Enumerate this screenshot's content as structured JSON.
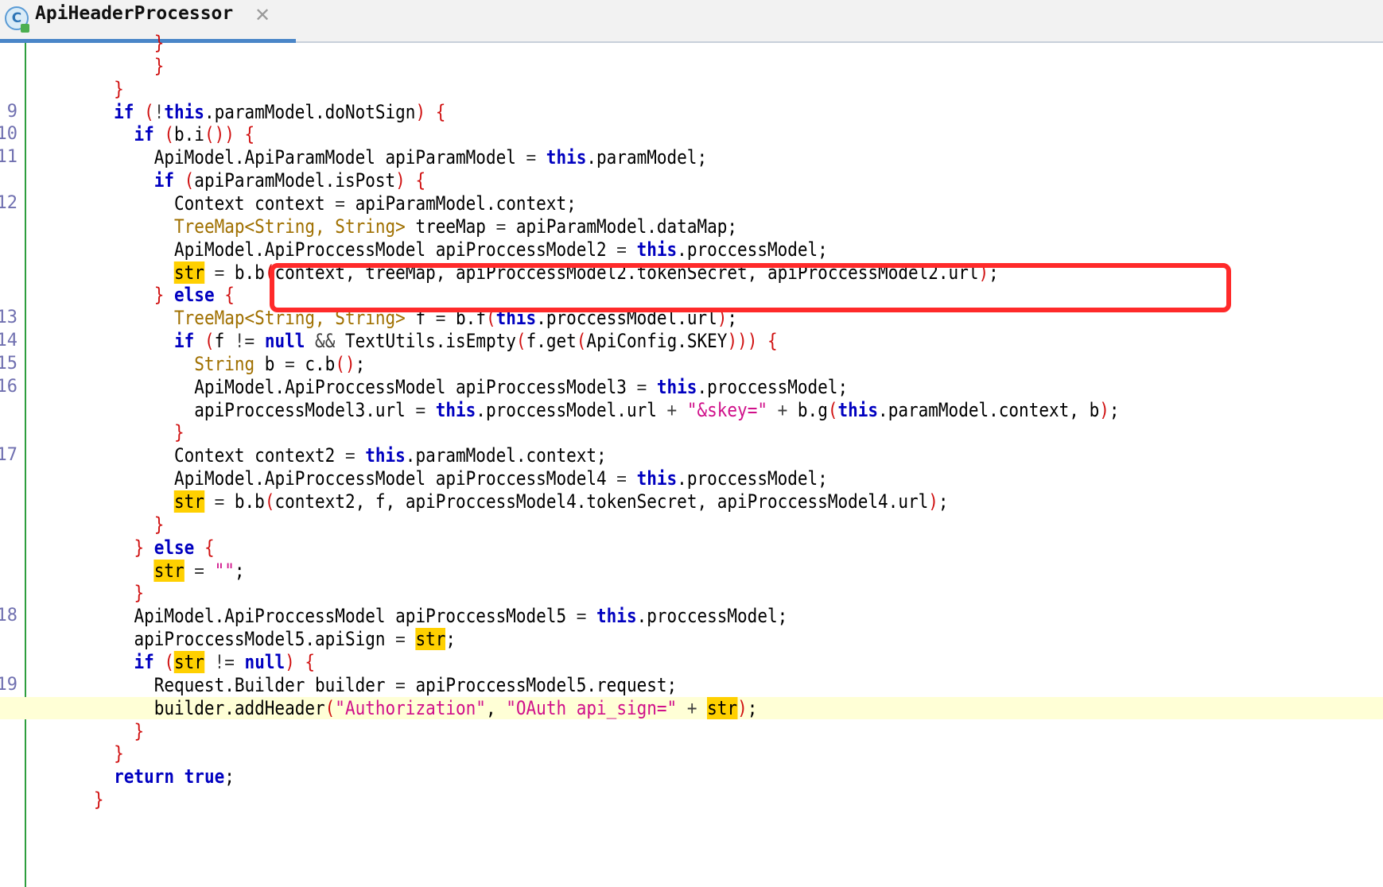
{
  "tab": {
    "title": "ApiHeaderProcessor",
    "icon_letter": "C",
    "icon": "java-class-icon",
    "close_icon": "close-icon"
  },
  "colors": {
    "keyword": "#0000c0",
    "bracket": "#d01010",
    "type": "#a07000",
    "string": "#d0108a",
    "highlight": "#ffd000",
    "current_line": "#ffffd6",
    "callout": "#ff2a2a",
    "gutter_border": "#2e9e3e"
  },
  "code_lines": [
    {
      "ln": "",
      "indent": 12,
      "cut_top": true,
      "tokens": [
        {
          "t": "}",
          "k": "br"
        }
      ]
    },
    {
      "ln": "",
      "indent": 12,
      "tokens": [
        {
          "t": "}",
          "k": "br"
        }
      ]
    },
    {
      "ln": "",
      "indent": 8,
      "tokens": [
        {
          "t": "}",
          "k": "br"
        }
      ]
    },
    {
      "ln": "9",
      "indent": 8,
      "tokens": [
        {
          "t": "if",
          "k": "kw"
        },
        {
          "t": " ",
          "k": "pl"
        },
        {
          "t": "(",
          "k": "br"
        },
        {
          "t": "!",
          "k": "op"
        },
        {
          "t": "this",
          "k": "kw"
        },
        {
          "t": ".paramModel.doNotSign",
          "k": "pl"
        },
        {
          "t": ")",
          "k": "br"
        },
        {
          "t": " ",
          "k": "pl"
        },
        {
          "t": "{",
          "k": "br"
        }
      ]
    },
    {
      "ln": "10",
      "indent": 10,
      "tokens": [
        {
          "t": "if",
          "k": "kw"
        },
        {
          "t": " ",
          "k": "pl"
        },
        {
          "t": "(",
          "k": "br"
        },
        {
          "t": "b.i",
          "k": "pl"
        },
        {
          "t": "())",
          "k": "br"
        },
        {
          "t": " ",
          "k": "pl"
        },
        {
          "t": "{",
          "k": "br"
        }
      ]
    },
    {
      "ln": "11",
      "indent": 12,
      "tokens": [
        {
          "t": "ApiModel.ApiParamModel apiParamModel ",
          "k": "pl"
        },
        {
          "t": "=",
          "k": "op"
        },
        {
          "t": " ",
          "k": "pl"
        },
        {
          "t": "this",
          "k": "kw"
        },
        {
          "t": ".paramModel;",
          "k": "pl"
        }
      ]
    },
    {
      "ln": "",
      "indent": 12,
      "tokens": [
        {
          "t": "if",
          "k": "kw"
        },
        {
          "t": " ",
          "k": "pl"
        },
        {
          "t": "(",
          "k": "br"
        },
        {
          "t": "apiParamModel.isPost",
          "k": "pl"
        },
        {
          "t": ")",
          "k": "br"
        },
        {
          "t": " ",
          "k": "pl"
        },
        {
          "t": "{",
          "k": "br"
        }
      ]
    },
    {
      "ln": "12",
      "indent": 14,
      "tokens": [
        {
          "t": "Context context ",
          "k": "pl"
        },
        {
          "t": "=",
          "k": "op"
        },
        {
          "t": " apiParamModel.context;",
          "k": "pl"
        }
      ]
    },
    {
      "ln": "",
      "indent": 14,
      "tokens": [
        {
          "t": "TreeMap<String, String>",
          "k": "ty"
        },
        {
          "t": " treeMap ",
          "k": "pl"
        },
        {
          "t": "=",
          "k": "op"
        },
        {
          "t": " apiParamModel.dataMap;",
          "k": "pl"
        }
      ]
    },
    {
      "ln": "",
      "indent": 14,
      "obscured": true,
      "tokens": [
        {
          "t": "ApiModel.ApiProccessModel apiProccessModel2 ",
          "k": "pl"
        },
        {
          "t": "=",
          "k": "op"
        },
        {
          "t": " ",
          "k": "pl"
        },
        {
          "t": "this",
          "k": "kw"
        },
        {
          "t": ".proccessModel;",
          "k": "pl"
        }
      ]
    },
    {
      "ln": "",
      "indent": 14,
      "tokens": [
        {
          "t": "str",
          "k": "hl"
        },
        {
          "t": " ",
          "k": "pl"
        },
        {
          "t": "=",
          "k": "op"
        },
        {
          "t": " b.b",
          "k": "pl"
        },
        {
          "t": "(",
          "k": "br"
        },
        {
          "t": "context, treeMap, apiProccessModel2.tokenSecret, apiProccessModel2.url",
          "k": "pl"
        },
        {
          "t": ")",
          "k": "br"
        },
        {
          "t": ";",
          "k": "pl"
        }
      ]
    },
    {
      "ln": "",
      "indent": 12,
      "obscured": true,
      "tokens": [
        {
          "t": "}",
          "k": "br"
        },
        {
          "t": " ",
          "k": "pl"
        },
        {
          "t": "else",
          "k": "kw"
        },
        {
          "t": " ",
          "k": "pl"
        },
        {
          "t": "{",
          "k": "br"
        }
      ]
    },
    {
      "ln": "13",
      "indent": 14,
      "tokens": [
        {
          "t": "TreeMap<String, String>",
          "k": "ty"
        },
        {
          "t": " f ",
          "k": "pl"
        },
        {
          "t": "=",
          "k": "op"
        },
        {
          "t": " b.f",
          "k": "pl"
        },
        {
          "t": "(",
          "k": "br"
        },
        {
          "t": "this",
          "k": "kw"
        },
        {
          "t": ".proccessModel.url",
          "k": "pl"
        },
        {
          "t": ")",
          "k": "br"
        },
        {
          "t": ";",
          "k": "pl"
        }
      ]
    },
    {
      "ln": "14",
      "indent": 14,
      "tokens": [
        {
          "t": "if",
          "k": "kw"
        },
        {
          "t": " ",
          "k": "pl"
        },
        {
          "t": "(",
          "k": "br"
        },
        {
          "t": "f ",
          "k": "pl"
        },
        {
          "t": "!=",
          "k": "op"
        },
        {
          "t": " ",
          "k": "pl"
        },
        {
          "t": "null",
          "k": "kw"
        },
        {
          "t": " ",
          "k": "pl"
        },
        {
          "t": "&&",
          "k": "op"
        },
        {
          "t": " TextUtils.isEmpty",
          "k": "pl"
        },
        {
          "t": "(",
          "k": "br"
        },
        {
          "t": "f.get",
          "k": "pl"
        },
        {
          "t": "(",
          "k": "br"
        },
        {
          "t": "ApiConfig.SKEY",
          "k": "pl"
        },
        {
          "t": ")))",
          "k": "br"
        },
        {
          "t": " ",
          "k": "pl"
        },
        {
          "t": "{",
          "k": "br"
        }
      ]
    },
    {
      "ln": "15",
      "indent": 16,
      "tokens": [
        {
          "t": "String",
          "k": "ty"
        },
        {
          "t": " b ",
          "k": "pl"
        },
        {
          "t": "=",
          "k": "op"
        },
        {
          "t": " c.b",
          "k": "pl"
        },
        {
          "t": "()",
          "k": "br"
        },
        {
          "t": ";",
          "k": "pl"
        }
      ]
    },
    {
      "ln": "16",
      "indent": 16,
      "tokens": [
        {
          "t": "ApiModel.ApiProccessModel apiProccessModel3 ",
          "k": "pl"
        },
        {
          "t": "=",
          "k": "op"
        },
        {
          "t": " ",
          "k": "pl"
        },
        {
          "t": "this",
          "k": "kw"
        },
        {
          "t": ".proccessModel;",
          "k": "pl"
        }
      ]
    },
    {
      "ln": "",
      "indent": 16,
      "tokens": [
        {
          "t": "apiProccessModel3.url ",
          "k": "pl"
        },
        {
          "t": "=",
          "k": "op"
        },
        {
          "t": " ",
          "k": "pl"
        },
        {
          "t": "this",
          "k": "kw"
        },
        {
          "t": ".proccessModel.url ",
          "k": "pl"
        },
        {
          "t": "+",
          "k": "op"
        },
        {
          "t": " ",
          "k": "pl"
        },
        {
          "t": "\"&skey=\"",
          "k": "st"
        },
        {
          "t": " ",
          "k": "pl"
        },
        {
          "t": "+",
          "k": "op"
        },
        {
          "t": " b.g",
          "k": "pl"
        },
        {
          "t": "(",
          "k": "br"
        },
        {
          "t": "this",
          "k": "kw"
        },
        {
          "t": ".paramModel.context, b",
          "k": "pl"
        },
        {
          "t": ")",
          "k": "br"
        },
        {
          "t": ";",
          "k": "pl"
        }
      ]
    },
    {
      "ln": "",
      "indent": 14,
      "tokens": [
        {
          "t": "}",
          "k": "br"
        }
      ]
    },
    {
      "ln": "17",
      "indent": 14,
      "tokens": [
        {
          "t": "Context context2 ",
          "k": "pl"
        },
        {
          "t": "=",
          "k": "op"
        },
        {
          "t": " ",
          "k": "pl"
        },
        {
          "t": "this",
          "k": "kw"
        },
        {
          "t": ".paramModel.context;",
          "k": "pl"
        }
      ]
    },
    {
      "ln": "",
      "indent": 14,
      "tokens": [
        {
          "t": "ApiModel.ApiProccessModel apiProccessModel4 ",
          "k": "pl"
        },
        {
          "t": "=",
          "k": "op"
        },
        {
          "t": " ",
          "k": "pl"
        },
        {
          "t": "this",
          "k": "kw"
        },
        {
          "t": ".proccessModel;",
          "k": "pl"
        }
      ]
    },
    {
      "ln": "",
      "indent": 14,
      "tokens": [
        {
          "t": "str",
          "k": "hl"
        },
        {
          "t": " ",
          "k": "pl"
        },
        {
          "t": "=",
          "k": "op"
        },
        {
          "t": " b.b",
          "k": "pl"
        },
        {
          "t": "(",
          "k": "br"
        },
        {
          "t": "context2, f, apiProccessModel4.tokenSecret, apiProccessModel4.url",
          "k": "pl"
        },
        {
          "t": ")",
          "k": "br"
        },
        {
          "t": ";",
          "k": "pl"
        }
      ]
    },
    {
      "ln": "",
      "indent": 12,
      "tokens": [
        {
          "t": "}",
          "k": "br"
        }
      ]
    },
    {
      "ln": "",
      "indent": 10,
      "tokens": [
        {
          "t": "}",
          "k": "br"
        },
        {
          "t": " ",
          "k": "pl"
        },
        {
          "t": "else",
          "k": "kw"
        },
        {
          "t": " ",
          "k": "pl"
        },
        {
          "t": "{",
          "k": "br"
        }
      ]
    },
    {
      "ln": "",
      "indent": 12,
      "tokens": [
        {
          "t": "str",
          "k": "hl"
        },
        {
          "t": " ",
          "k": "pl"
        },
        {
          "t": "=",
          "k": "op"
        },
        {
          "t": " ",
          "k": "pl"
        },
        {
          "t": "\"\"",
          "k": "st"
        },
        {
          "t": ";",
          "k": "pl"
        }
      ]
    },
    {
      "ln": "",
      "indent": 10,
      "tokens": [
        {
          "t": "}",
          "k": "br"
        }
      ]
    },
    {
      "ln": "18",
      "indent": 10,
      "tokens": [
        {
          "t": "ApiModel.ApiProccessModel apiProccessModel5 ",
          "k": "pl"
        },
        {
          "t": "=",
          "k": "op"
        },
        {
          "t": " ",
          "k": "pl"
        },
        {
          "t": "this",
          "k": "kw"
        },
        {
          "t": ".proccessModel;",
          "k": "pl"
        }
      ]
    },
    {
      "ln": "",
      "indent": 10,
      "tokens": [
        {
          "t": "apiProccessModel5.apiSign ",
          "k": "pl"
        },
        {
          "t": "=",
          "k": "op"
        },
        {
          "t": " ",
          "k": "pl"
        },
        {
          "t": "str",
          "k": "hl"
        },
        {
          "t": ";",
          "k": "pl"
        }
      ]
    },
    {
      "ln": "",
      "indent": 10,
      "tokens": [
        {
          "t": "if",
          "k": "kw"
        },
        {
          "t": " ",
          "k": "pl"
        },
        {
          "t": "(",
          "k": "br"
        },
        {
          "t": "str",
          "k": "hl"
        },
        {
          "t": " ",
          "k": "pl"
        },
        {
          "t": "!=",
          "k": "op"
        },
        {
          "t": " ",
          "k": "pl"
        },
        {
          "t": "null",
          "k": "kw"
        },
        {
          "t": ")",
          "k": "br"
        },
        {
          "t": " ",
          "k": "pl"
        },
        {
          "t": "{",
          "k": "br"
        }
      ]
    },
    {
      "ln": "19",
      "indent": 12,
      "tokens": [
        {
          "t": "Request.Builder builder ",
          "k": "pl"
        },
        {
          "t": "=",
          "k": "op"
        },
        {
          "t": " apiProccessModel5.request;",
          "k": "pl"
        }
      ]
    },
    {
      "ln": "",
      "indent": 12,
      "current": true,
      "tokens": [
        {
          "t": "builder.addHeader",
          "k": "pl"
        },
        {
          "t": "(",
          "k": "br"
        },
        {
          "t": "\"Authorization\"",
          "k": "st"
        },
        {
          "t": ", ",
          "k": "pl"
        },
        {
          "t": "\"OAuth api_sign=\"",
          "k": "st"
        },
        {
          "t": " ",
          "k": "pl"
        },
        {
          "t": "+",
          "k": "op"
        },
        {
          "t": " ",
          "k": "pl"
        },
        {
          "t": "str",
          "k": "hl"
        },
        {
          "t": ")",
          "k": "br"
        },
        {
          "t": ";",
          "k": "pl"
        }
      ]
    },
    {
      "ln": "",
      "indent": 10,
      "tokens": [
        {
          "t": "}",
          "k": "br"
        }
      ]
    },
    {
      "ln": "",
      "indent": 8,
      "tokens": [
        {
          "t": "}",
          "k": "br"
        }
      ]
    },
    {
      "ln": "",
      "indent": 8,
      "tokens": [
        {
          "t": "return",
          "k": "kw"
        },
        {
          "t": " ",
          "k": "pl"
        },
        {
          "t": "true",
          "k": "kw"
        },
        {
          "t": ";",
          "k": "pl"
        }
      ]
    },
    {
      "ln": "",
      "indent": 6,
      "tokens": [
        {
          "t": "}",
          "k": "br"
        }
      ]
    }
  ]
}
